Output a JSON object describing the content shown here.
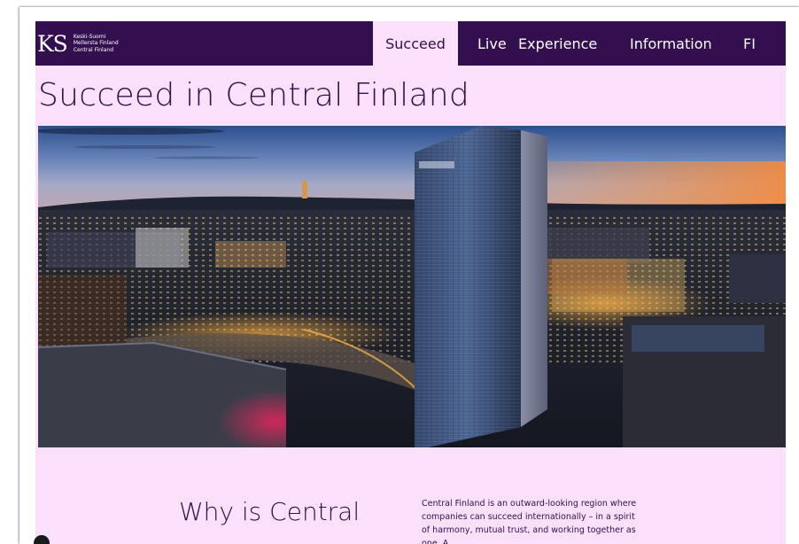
{
  "header": {
    "logo": {
      "mark": "KS",
      "lines": [
        "Keski-Suomi",
        "Mellersta Finland",
        "Central Finland"
      ]
    },
    "nav": [
      {
        "label": "Succeed",
        "active": true
      },
      {
        "label": "Live",
        "active": false
      },
      {
        "label": "Experience",
        "active": false
      },
      {
        "label": "Information",
        "active": false
      },
      {
        "label": "FI",
        "active": false
      }
    ]
  },
  "hero": {
    "title": "Succeed in Central Finland",
    "image": "night city skyline with glass tower"
  },
  "intro": {
    "heading": "Why is Central",
    "text": "Central Finland is an outward-looking region where companies can succeed internationally – in a spirit of harmony, mutual trust, and working together as one. A"
  },
  "colors": {
    "brand_purple": "#330f4f",
    "page_background": "#fde0fc",
    "nav_text": "#ffffff"
  }
}
